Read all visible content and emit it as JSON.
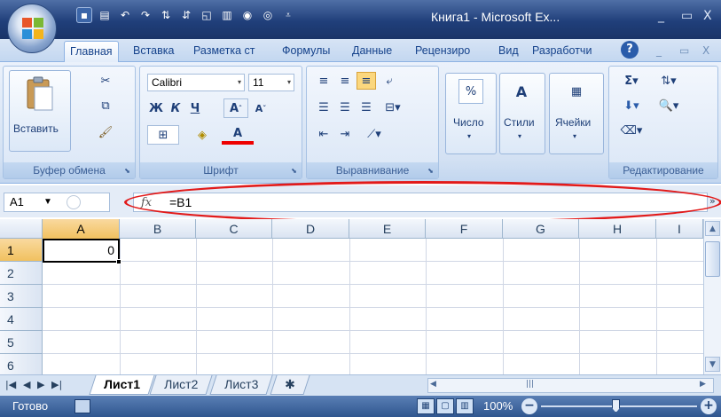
{
  "window": {
    "title": "Книга1 - Microsoft Ex...",
    "controls": {
      "minimize": "_",
      "maximize": "▭",
      "close": "X"
    }
  },
  "ribbon_tabs": [
    "Главная",
    "Вставка",
    "Разметка ст",
    "Формулы",
    "Данные",
    "Рецензиро",
    "Вид",
    "Разработчи"
  ],
  "clipboard": {
    "paste_label": "Вставить",
    "group_label": "Буфер обмена"
  },
  "font": {
    "name": "Calibri",
    "size": "11",
    "group_label": "Шрифт",
    "bold": "Ж",
    "italic": "К",
    "underline": "Ч"
  },
  "alignment": {
    "group_label": "Выравнивание"
  },
  "number": {
    "label": "Число",
    "percent": "%"
  },
  "styles": {
    "label": "Стили"
  },
  "cells": {
    "label": "Ячейки"
  },
  "editing": {
    "group_label": "Редактирование",
    "sigma": "Σ"
  },
  "formula_bar": {
    "name_box": "A1",
    "fx": "fx",
    "formula": "=B1"
  },
  "grid": {
    "columns": [
      "A",
      "B",
      "C",
      "D",
      "E",
      "F",
      "G",
      "H",
      "I"
    ],
    "rows": [
      "1",
      "2",
      "3",
      "4",
      "5",
      "6"
    ],
    "active_cell_value": "0"
  },
  "sheets": [
    "Лист1",
    "Лист2",
    "Лист3"
  ],
  "status": {
    "ready": "Готово",
    "zoom": "100%"
  },
  "colors": {
    "annotation": "#e21a1a",
    "title_bar": "#203f7a",
    "ribbon": "#d3e1f3"
  }
}
